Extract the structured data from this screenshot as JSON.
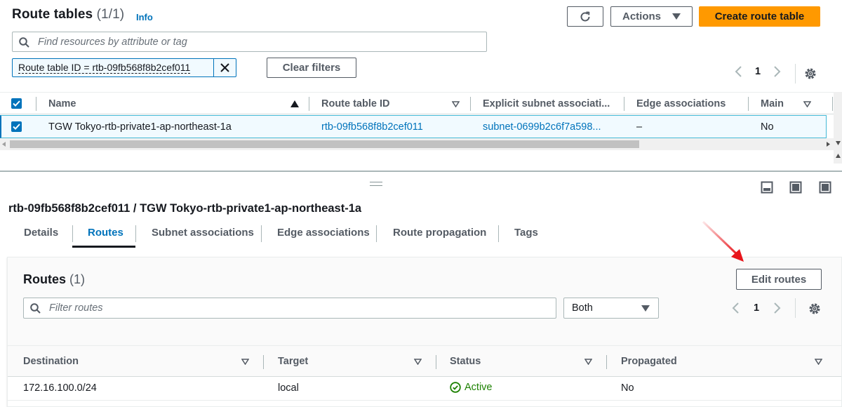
{
  "header": {
    "title": "Route tables",
    "count": "(1/1)",
    "info": "Info",
    "actions_label": "Actions",
    "create_label": "Create route table"
  },
  "filters": {
    "search_placeholder": "Find resources by attribute or tag",
    "token": "Route table ID = rtb-09fb568f8b2cef011",
    "clear_label": "Clear filters"
  },
  "top_pager": {
    "page": "1"
  },
  "table": {
    "columns": [
      "Name",
      "Route table ID",
      "Explicit subnet associati...",
      "Edge associations",
      "Main"
    ],
    "rows": [
      {
        "name": "TGW Tokyo-rtb-private1-ap-northeast-1a",
        "route_table_id": "rtb-09fb568f8b2cef011",
        "explicit_subnet": "subnet-0699b2c6f7a598...",
        "edge": "–",
        "main": "No"
      }
    ]
  },
  "detail": {
    "title": "rtb-09fb568f8b2cef011 / TGW Tokyo-rtb-private1-ap-northeast-1a",
    "tabs": [
      "Details",
      "Routes",
      "Subnet associations",
      "Edge associations",
      "Route propagation",
      "Tags"
    ],
    "active_tab": "Routes"
  },
  "routes": {
    "title": "Routes",
    "count": "(1)",
    "edit_label": "Edit routes",
    "filter_placeholder": "Filter routes",
    "select_value": "Both",
    "page": "1",
    "columns": [
      "Destination",
      "Target",
      "Status",
      "Propagated"
    ],
    "rows": [
      {
        "destination": "172.16.100.0/24",
        "target": "local",
        "status": "Active",
        "propagated": "No"
      }
    ]
  },
  "colors": {
    "primary_orange": "#ff9900",
    "link_blue": "#0073bb",
    "status_green": "#1d8102",
    "annotation_red": "#e8151b"
  }
}
